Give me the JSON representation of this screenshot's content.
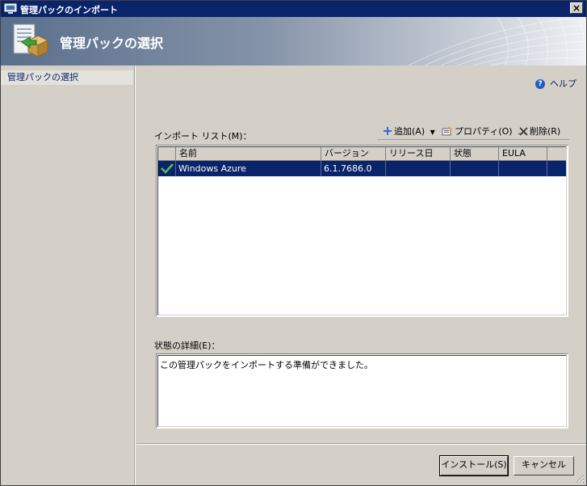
{
  "window": {
    "title": "管理パックのインポート",
    "close_glyph": "×"
  },
  "banner": {
    "title": "管理パックの選択"
  },
  "nav": {
    "items": [
      {
        "label": "管理パックの選択"
      }
    ]
  },
  "help": {
    "label": "ヘルプ"
  },
  "import_list": {
    "label": "インポート リスト(M)：",
    "toolbar": {
      "add": "追加(A)",
      "properties": "プロパティ(O)",
      "ellipsis": "…",
      "delete": "削除(R)"
    },
    "columns": [
      "名前",
      "バージョン",
      "リリース日",
      "状態",
      "EULA"
    ],
    "rows": [
      {
        "status_icon": "checkmark-icon",
        "name": "Windows Azure",
        "version": "6.1.7686.0",
        "release_date": "",
        "state": "",
        "eula": ""
      }
    ]
  },
  "details": {
    "label": "状態の詳細(E)：",
    "text": "この管理パックをインポートする準備ができました。"
  },
  "buttons": {
    "install": "インストール(S)",
    "cancel": "キャンセル"
  },
  "colors": {
    "title_bar": "#0a246a",
    "selection": "#0a246a",
    "dialog_bg": "#d4d0c8"
  }
}
